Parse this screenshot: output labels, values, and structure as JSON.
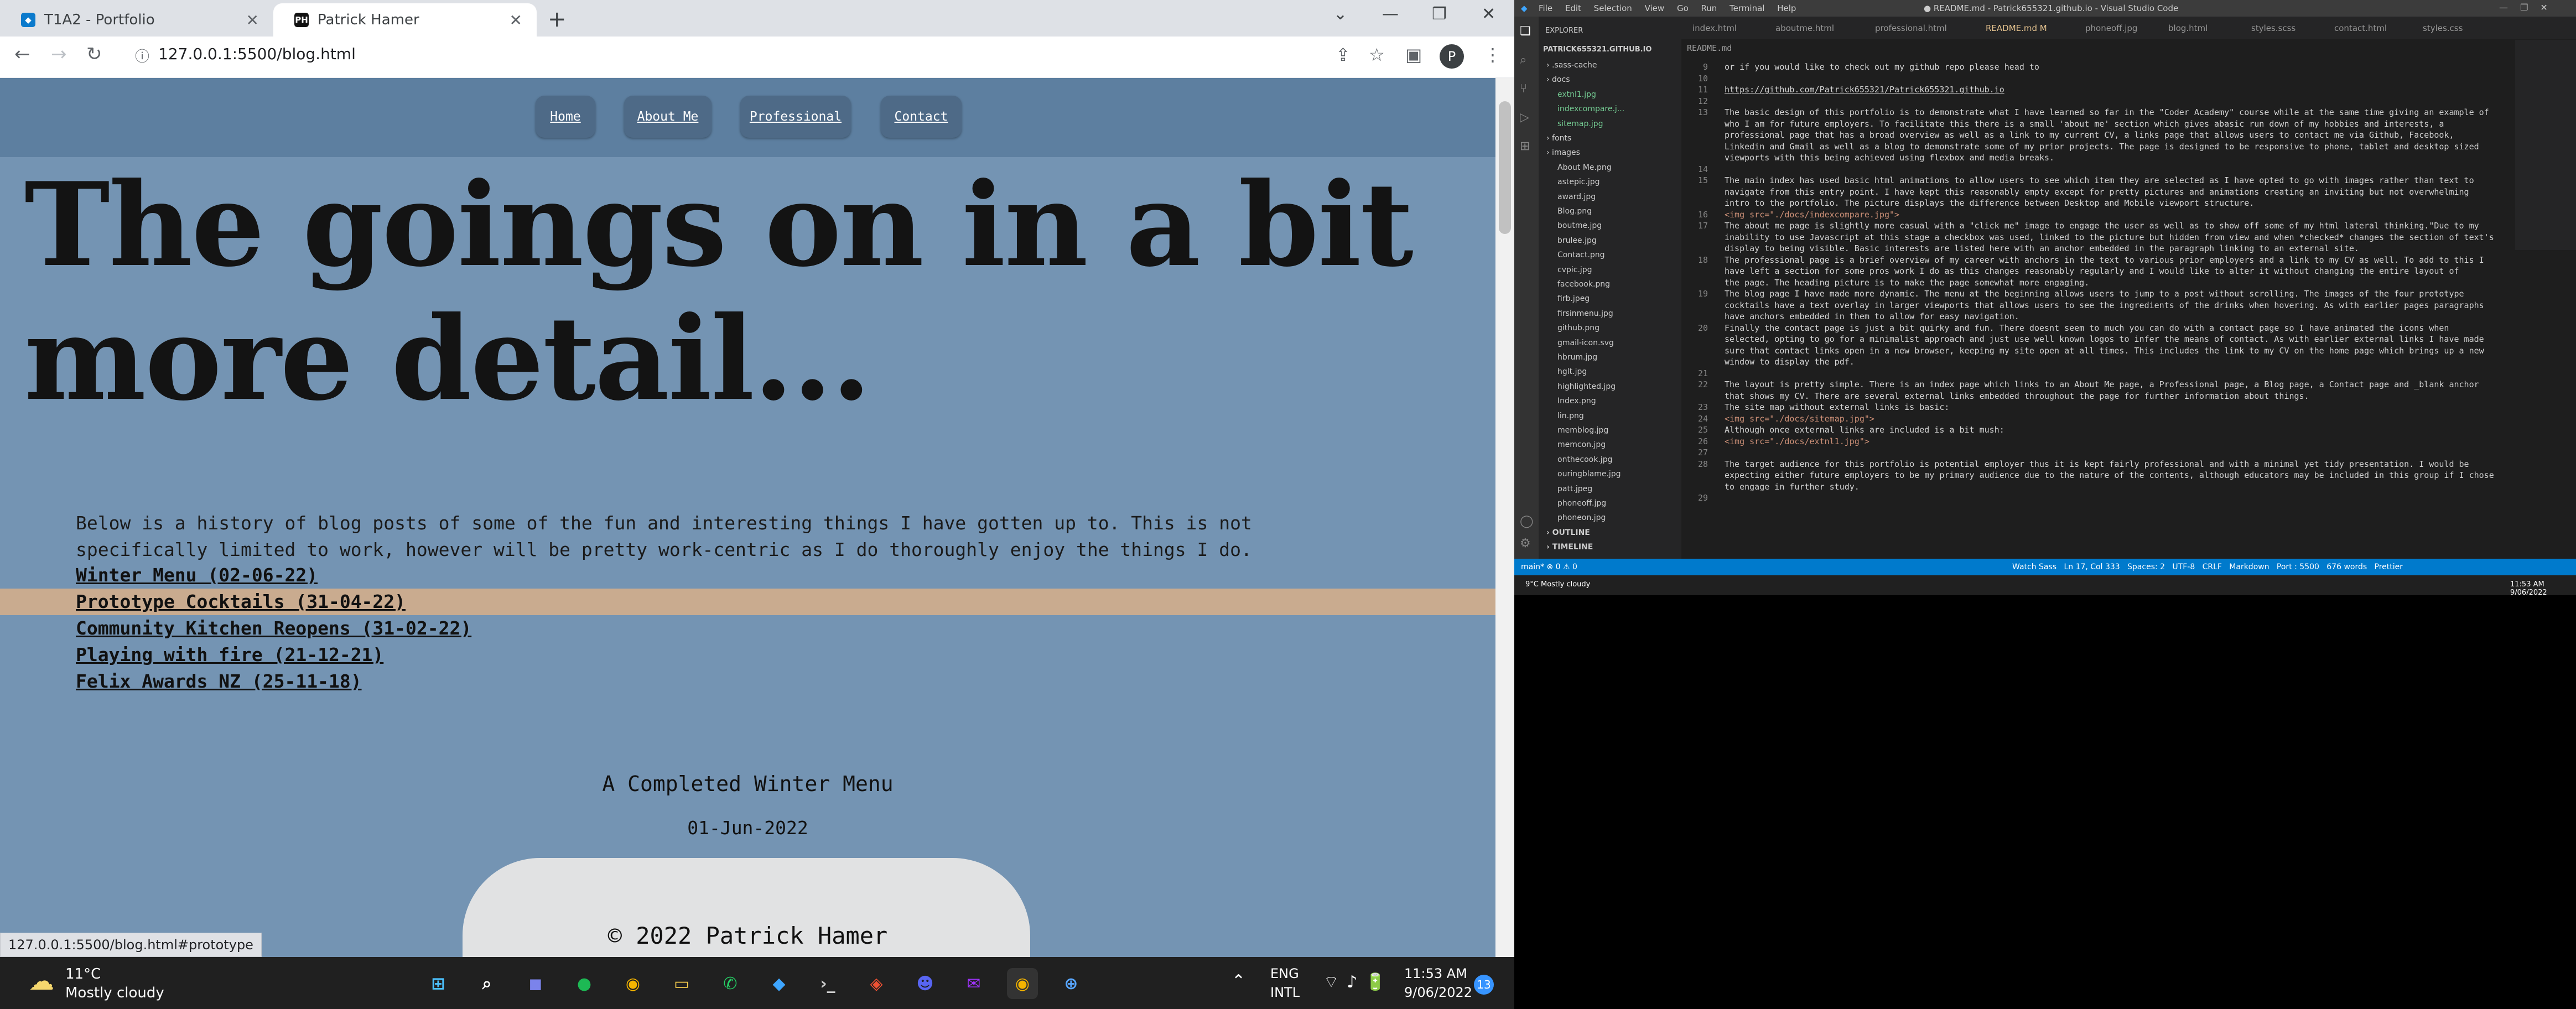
{
  "browser": {
    "tabs": [
      {
        "label": "T1A2 - Portfolio",
        "favicon": "vscode-favicon"
      },
      {
        "label": "Patrick Hamer",
        "favicon": "PH"
      }
    ],
    "url": "127.0.0.1:5500/blog.html",
    "profile_initial": "P",
    "status_url": "127.0.0.1:5500/blog.html#prototype"
  },
  "site": {
    "nav": [
      "Home",
      "About Me",
      "Professional",
      "Contact"
    ],
    "headline": "The goings on in a bit more detail...",
    "intro": "Below is a history of blog posts of some of the fun and interesting things I have gotten up to. This is not specifically limited to work, however will be pretty work-centric as I do thoroughly enjoy the things I do.",
    "posts": [
      "Winter Menu (02-06-22)",
      "Prototype Cocktails (31-04-22)",
      "Community Kitchen Reopens (31-02-22)",
      "Playing with fire (21-12-21)",
      "Felix Awards NZ (25-11-18)"
    ],
    "current_post_title": "A Completed Winter Menu",
    "current_post_date": "01-Jun-2022",
    "footer": "© 2022 Patrick Hamer",
    "colors": {
      "page_bg": "#7494b3",
      "nav_bg": "#5d7fa0",
      "button_bg": "#4e6a87",
      "highlight": "#c9ab8f"
    }
  },
  "vscode": {
    "menu": [
      "File",
      "Edit",
      "Selection",
      "View",
      "Go",
      "Run",
      "Terminal",
      "Help"
    ],
    "title": "● README.md - Patrick655321.github.io - Visual Studio Code",
    "explorer_label": "EXPLORER",
    "project": "PATRICK655321.GITHUB.IO",
    "tabs": [
      "index.html",
      "aboutme.html",
      "professional.html",
      "README.md M",
      "phoneoff.jpg",
      "blog.html",
      "styles.scss",
      "contact.html",
      "styles.css"
    ],
    "breadcrumb": "README.md",
    "tree": [
      ".sass-cache",
      "docs",
      "extnl1.jpg",
      "indexcompare.j...",
      "sitemap.jpg",
      "fonts",
      "images",
      "About Me.png",
      "astepic.jpg",
      "award.jpg",
      "Blog.png",
      "boutme.jpg",
      "brulee.jpg",
      "Contact.png",
      "cvpic.jpg",
      "facebook.png",
      "firb.jpeg",
      "firsinmenu.jpg",
      "github.png",
      "gmail-icon.svg",
      "hbrum.jpg",
      "hglt.jpg",
      "highlighted.jpg",
      "Index.png",
      "lin.png",
      "memblog.jpg",
      "memcon.jpg",
      "onthecook.jpg",
      "ouringblame.jpg",
      "patt.jpeg",
      "phoneoff.jpg",
      "phoneon.jpg",
      "OUTLINE",
      "TIMELINE"
    ],
    "lines": [
      {
        "n": "9",
        "t": "or if you would like to check out my github repo please head to"
      },
      {
        "n": "10",
        "t": ""
      },
      {
        "n": "11",
        "t": "https://github.com/Patrick655321/Patrick655321.github.io"
      },
      {
        "n": "12",
        "t": ""
      },
      {
        "n": "13",
        "t": "The basic design of this portfolio is to demonstrate what I have learned so far in the \"Coder Academy\" course while at the same time giving an example of"
      },
      {
        "n": "",
        "t": "who I am for future employers. To facilitate this there is a small 'about me' section which gives abasic run down of my hobbies and interests, a"
      },
      {
        "n": "",
        "t": "professional page that has a broad overview as well as a link to my current CV, a links page that allows users to contact me via Github, Facebook,"
      },
      {
        "n": "",
        "t": "Linkedin and Gmail as well as a blog to demonstrate some of my prior projects.  The page is designed to be responsive to phone, tablet and desktop sized"
      },
      {
        "n": "",
        "t": "viewports with this being achieved using flexbox and media breaks."
      },
      {
        "n": "14",
        "t": ""
      },
      {
        "n": "15",
        "t": "The main index has used basic html animations to allow users to see which item they are selected as I have opted to go with images rather than text to"
      },
      {
        "n": "",
        "t": "navigate from this entry point. I have kept this reasonably empty except for pretty pictures and animations creating an inviting but not overwhelming"
      },
      {
        "n": "",
        "t": "intro to the portfolio.  The picture displays the difference between Desktop and Mobile viewport structure."
      },
      {
        "n": "16",
        "t": "<img src=\"./docs/indexcompare.jpg\">"
      },
      {
        "n": "17",
        "t": "The about me page is slightly more casual with a \"click me\" image to engage the user as well as to show off some of my html lateral thinking.\"Due to my"
      },
      {
        "n": "",
        "t": "inability to use Javascript at this stage a checkbox was used, linked to the picture but hidden from view and when *checked* changes the section of text's"
      },
      {
        "n": "",
        "t": "display to being visible. Basic interests are listed here with an anchor embedded in the paragraph linking to an external site."
      },
      {
        "n": "18",
        "t": "The professional page is a brief overview of my career with anchors in the text to various prior employers and a link to my CV as well. To add to this I"
      },
      {
        "n": "",
        "t": "have left a section for some pros work I do as this changes reasonably regularly and I would like to alter it without changing the entire layout of"
      },
      {
        "n": "",
        "t": "the page. The heading picture is to make the page somewhat more engaging."
      },
      {
        "n": "19",
        "t": "The blog page I have made more dynamic. The menu at the beginning allows users to jump to a post without scrolling. The images of the four prototype"
      },
      {
        "n": "",
        "t": "cocktails have a text overlay in larger viewports that allows users to see the ingredients of the drinks when hovering. As with earlier pages paragraphs"
      },
      {
        "n": "",
        "t": "have anchors embedded in them to allow for easy navigation."
      },
      {
        "n": "20",
        "t": "Finally the contact page is just a bit quirky and fun. There doesnt seem to much you can do with a contact page so I have animated the icons when"
      },
      {
        "n": "",
        "t": "selected, opting to go for a minimalist approach and just use well known logos to infer the means of contact. As with earlier external links I have made"
      },
      {
        "n": "",
        "t": "sure that contact links open in a new browser, keeping my site open at all times. This includes the link to my CV on the home page which brings up a new"
      },
      {
        "n": "",
        "t": "window to display the pdf."
      },
      {
        "n": "21",
        "t": ""
      },
      {
        "n": "22",
        "t": "The layout is pretty simple. There is an index page which links to an About Me page, a Professional page, a Blog page, a Contact page and _blank anchor"
      },
      {
        "n": "",
        "t": "that shows my CV. There are several external links embedded throughout the page for further information about things."
      },
      {
        "n": "23",
        "t": "The site map without external links is basic:"
      },
      {
        "n": "24",
        "t": "<img src=\"./docs/sitemap.jpg\">"
      },
      {
        "n": "25",
        "t": "Although once external links are included is a bit mush:"
      },
      {
        "n": "26",
        "t": "<img src=\"./docs/extnl1.jpg\">"
      },
      {
        "n": "27",
        "t": ""
      },
      {
        "n": "28",
        "t": "The target audience for this portfolio is potential employer thus it is kept fairly professional and with a minimal yet tidy presentation. I would be"
      },
      {
        "n": "",
        "t": "expecting either future employers to be my primary audience due to the nature of the contents, although educators may be included in this group if I chose"
      },
      {
        "n": "",
        "t": "to engage in further study."
      },
      {
        "n": "29",
        "t": ""
      }
    ],
    "status_left": "main*   ⊗ 0 ⚠ 0",
    "status_right": "Watch Sass   Ln 17, Col 333   Spaces: 2   UTF-8   CRLF   Markdown   Port : 5500   676 words   Prettier",
    "mini_taskbar_weather": "9°C Mostly cloudy",
    "mini_taskbar_time": "11:53 AM 9/06/2022"
  },
  "taskbar": {
    "weather_temp": "11°C",
    "weather_desc": "Mostly cloudy",
    "lang": "ENG",
    "lang_sub": "INTL",
    "time": "11:53 AM",
    "date": "9/06/2022",
    "notifications": "13",
    "apps": [
      "windows-start-icon",
      "search-icon",
      "teams-icon",
      "spotify-icon",
      "chrome-icon",
      "file-explorer-icon",
      "whatsapp-icon",
      "vscode-icon",
      "terminal-icon",
      "gitbash-icon",
      "discord-icon",
      "messenger-icon",
      "chrome-canary-icon",
      "onedrive-icon"
    ]
  }
}
